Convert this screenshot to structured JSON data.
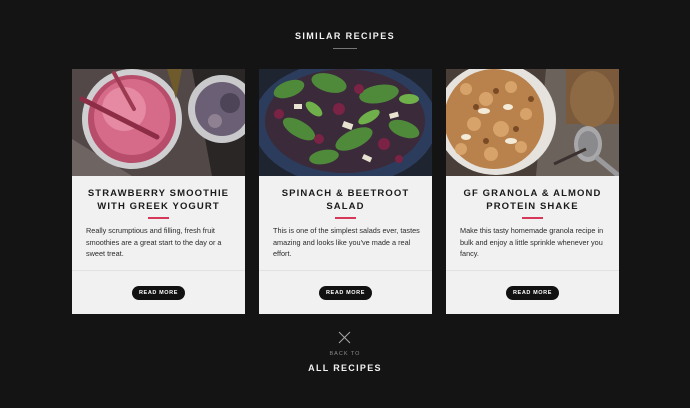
{
  "section": {
    "title": "SIMILAR RECIPES"
  },
  "cards": [
    {
      "title": "STRAWBERRY SMOOTHIE WITH GREEK YOGURT",
      "description": "Really scrumptious and filling, fresh fruit smoothies are a great start to the day or a sweet treat.",
      "button": "READ MORE",
      "image": "strawberry-smoothie-photo"
    },
    {
      "title": "SPINACH & BEETROOT SALAD",
      "description": "This is one of the simplest salads ever, tastes amazing and looks like you've made a real effort.",
      "button": "READ MORE",
      "image": "spinach-beetroot-salad-photo"
    },
    {
      "title": "GF GRANOLA & ALMOND PROTEIN SHAKE",
      "description": "Make this tasty homemade granola recipe in bulk and enjoy a little sprinkle whenever you fancy.",
      "button": "READ MORE",
      "image": "granola-protein-shake-photo"
    }
  ],
  "footer": {
    "back_to": "BACK TO",
    "all_recipes": "ALL RECIPES",
    "icon": "close-icon"
  },
  "colors": {
    "background": "#141414",
    "card": "#f1f1f1",
    "accent": "#d6385a",
    "button": "#111111"
  }
}
